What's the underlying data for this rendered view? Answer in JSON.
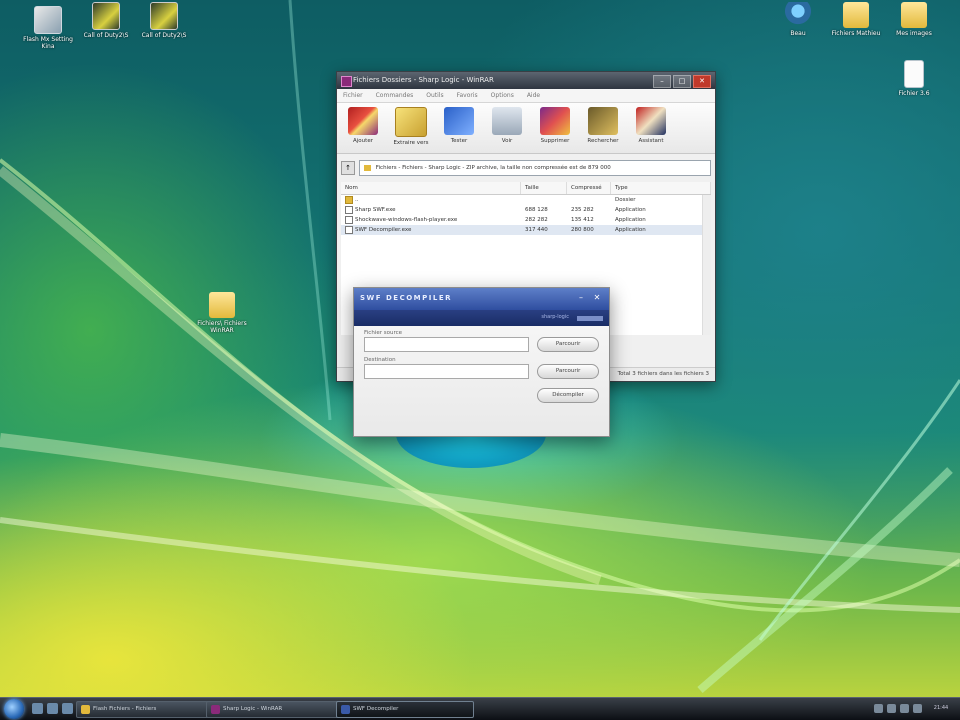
{
  "desktop": {
    "icons_left": [
      {
        "label": "Flash Mx Setting Kina",
        "icon": "setup-icon"
      },
      {
        "label": "Call of Duty2\\S",
        "icon": "exe-icon"
      },
      {
        "label": "Call of Duty2\\S",
        "icon": "exe-icon"
      }
    ],
    "icons_right": [
      {
        "label": "Beau",
        "icon": "user-icon"
      },
      {
        "label": "Fichiers Mathieu",
        "icon": "folder-icon"
      },
      {
        "label": "Mes images",
        "icon": "folder-icon"
      },
      {
        "label": "Fichier 3.6",
        "icon": "document-icon"
      }
    ],
    "icon_mid": {
      "label": "Fichiers\\ Fichiers WinRAR",
      "icon": "folder-icon"
    }
  },
  "winrar": {
    "title": "Fichiers Dossiers - Sharp Logic - WinRAR",
    "menu": [
      "Fichier",
      "Commandes",
      "Outils",
      "Favoris",
      "Options",
      "Aide"
    ],
    "toolbar": [
      {
        "label": "Ajouter",
        "icon": "add-archive-icon"
      },
      {
        "label": "Extraire vers",
        "icon": "extract-icon"
      },
      {
        "label": "Tester",
        "icon": "test-icon"
      },
      {
        "label": "Voir",
        "icon": "view-icon"
      },
      {
        "label": "Supprimer",
        "icon": "delete-icon"
      },
      {
        "label": "Rechercher",
        "icon": "find-icon"
      },
      {
        "label": "Assistant",
        "icon": "wizard-icon"
      }
    ],
    "path": "Fichiers - Fichiers - Sharp Logic - ZIP archive, la taille non compressée est de 879 000",
    "columns": [
      "Nom",
      "Taille",
      "Compressé",
      "Type"
    ],
    "rows": [
      {
        "name": "..",
        "size": "",
        "packed": "",
        "type": "Dossier",
        "kind": "folder"
      },
      {
        "name": "Sharp SWF.exe",
        "size": "688 128",
        "packed": "235 282",
        "type": "Application",
        "kind": "file"
      },
      {
        "name": "Shockwave-windows-flash-player.exe",
        "size": "282 282",
        "packed": "135 412",
        "type": "Application",
        "kind": "file"
      },
      {
        "name": "SWF Decompiler.exe",
        "size": "317 440",
        "packed": "280 800",
        "type": "Application",
        "kind": "file"
      }
    ],
    "status": "Total 3 fichiers dans les fichiers 3"
  },
  "decompiler": {
    "title": "SWF DECOMPILER",
    "site": "sharp-logic",
    "source_label": "Fichier source",
    "target_label": "Destination",
    "browse1": "Parcourir",
    "browse2": "Parcourir",
    "decompile": "Décompiler"
  },
  "taskbar": {
    "tasks": [
      {
        "label": "Flash Fichiers - Fichiers",
        "color": "#e2b93c",
        "active": false
      },
      {
        "label": "Sharp Logic - WinRAR",
        "color": "#8b2a7a",
        "active": false
      },
      {
        "label": "SWF Decompiler",
        "color": "#3a5aa8",
        "active": true
      }
    ],
    "clock": "21:44"
  },
  "colors": {
    "dialog_header": "#2f4ea0",
    "close_button": "#c0392b"
  }
}
